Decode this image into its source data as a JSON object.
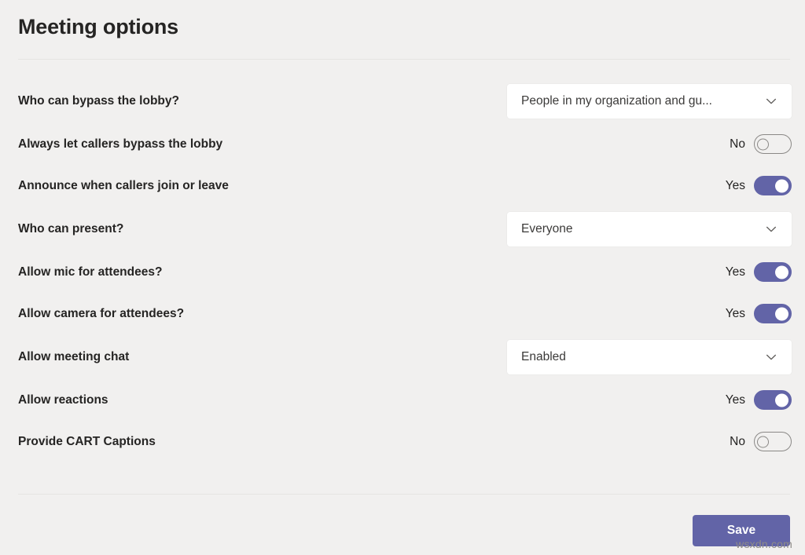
{
  "header": {
    "title": "Meeting options"
  },
  "options": [
    {
      "label": "Who can bypass the lobby?",
      "control": "dropdown",
      "value": "People in my organization and gu...",
      "icon": "chevron-down-icon",
      "name": "who-can-bypass-lobby"
    },
    {
      "label": "Always let callers bypass the lobby",
      "control": "toggle",
      "state": "No",
      "on": false,
      "name": "always-let-callers-bypass-lobby"
    },
    {
      "label": "Announce when callers join or leave",
      "control": "toggle",
      "state": "Yes",
      "on": true,
      "name": "announce-when-callers-join-or-leave"
    },
    {
      "label": "Who can present?",
      "control": "dropdown",
      "value": "Everyone",
      "icon": "chevron-down-icon",
      "name": "who-can-present"
    },
    {
      "label": "Allow mic for attendees?",
      "control": "toggle",
      "state": "Yes",
      "on": true,
      "name": "allow-mic-for-attendees"
    },
    {
      "label": "Allow camera for attendees?",
      "control": "toggle",
      "state": "Yes",
      "on": true,
      "name": "allow-camera-for-attendees"
    },
    {
      "label": "Allow meeting chat",
      "control": "dropdown",
      "value": "Enabled",
      "icon": "chevron-down-icon",
      "name": "allow-meeting-chat"
    },
    {
      "label": "Allow reactions",
      "control": "toggle",
      "state": "Yes",
      "on": true,
      "name": "allow-reactions"
    },
    {
      "label": "Provide CART Captions",
      "control": "toggle",
      "state": "No",
      "on": false,
      "name": "provide-cart-captions"
    }
  ],
  "footer": {
    "save_label": "Save"
  },
  "watermark": {
    "text": "wsxdn.com"
  },
  "colors": {
    "background": "#F1F0EF",
    "accent": "#6264A7",
    "text": "#252423",
    "control_surface": "#FFFFFF",
    "divider": "#E6E4E2",
    "toggle_off_border": "#8A8886"
  }
}
